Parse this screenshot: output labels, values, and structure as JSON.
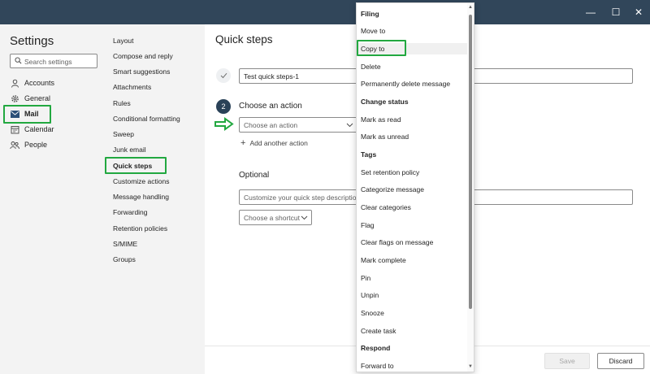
{
  "window": {
    "minimize_glyph": "—",
    "maximize_glyph": "☐",
    "close_glyph": "✕"
  },
  "settings": {
    "title": "Settings",
    "search_placeholder": "Search settings",
    "nav": [
      {
        "label": "Accounts",
        "icon": "person-icon"
      },
      {
        "label": "General",
        "icon": "gear-icon"
      },
      {
        "label": "Mail",
        "icon": "mail-icon",
        "selected": true
      },
      {
        "label": "Calendar",
        "icon": "calendar-icon"
      },
      {
        "label": "People",
        "icon": "people-icon"
      }
    ]
  },
  "mail_sections": [
    "Layout",
    "Compose and reply",
    "Smart suggestions",
    "Attachments",
    "Rules",
    "Conditional formatting",
    "Sweep",
    "Junk email",
    "Quick steps",
    "Customize actions",
    "Message handling",
    "Forwarding",
    "Retention policies",
    "S/MIME",
    "Groups"
  ],
  "selected_section": "Quick steps",
  "main": {
    "title": "Quick steps",
    "name_value": "Test quick steps-1",
    "step_number": "2",
    "choose_action_label": "Choose an action",
    "action_dropdown_value": "Choose an action",
    "add_action_label": "Add another action",
    "optional_label": "Optional",
    "description_placeholder": "Customize your quick step description",
    "shortcut_value": "Choose a shortcut",
    "save_label": "Save",
    "discard_label": "Discard"
  },
  "action_menu": [
    {
      "label": "Filing",
      "header": true
    },
    {
      "label": "Move to"
    },
    {
      "label": "Copy to",
      "highlighted": true
    },
    {
      "label": "Delete"
    },
    {
      "label": "Permanently delete message"
    },
    {
      "label": "Change status",
      "header": true
    },
    {
      "label": "Mark as read"
    },
    {
      "label": "Mark as unread"
    },
    {
      "label": "Tags",
      "header": true
    },
    {
      "label": "Set retention policy"
    },
    {
      "label": "Categorize message"
    },
    {
      "label": "Clear categories"
    },
    {
      "label": "Flag"
    },
    {
      "label": "Clear flags on message"
    },
    {
      "label": "Mark complete"
    },
    {
      "label": "Pin"
    },
    {
      "label": "Unpin"
    },
    {
      "label": "Snooze"
    },
    {
      "label": "Create task"
    },
    {
      "label": "Respond",
      "header": true
    },
    {
      "label": "Forward to"
    }
  ],
  "colors": {
    "titlebar": "#31465a",
    "highlight_box": "#22a840",
    "step_circle": "#2a4258"
  }
}
